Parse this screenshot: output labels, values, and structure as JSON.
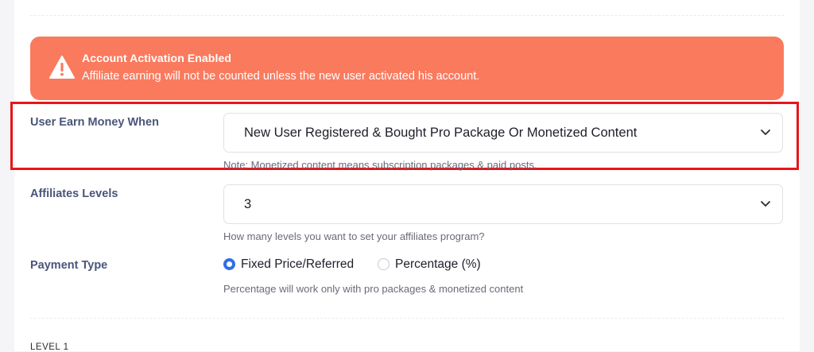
{
  "alert": {
    "title": "Account Activation Enabled",
    "message": "Affiliate earning will not be counted unless the new user activated his account.",
    "icon": "warning-triangle-icon",
    "color": "#fa7a5e"
  },
  "earn_money": {
    "label": "User Earn Money When",
    "selected": "New User Registered & Bought Pro Package Or Monetized Content",
    "note": "Note: Monetized content means subscription packages & paid posts.",
    "highlight_color": "#e8141a"
  },
  "affiliate_levels": {
    "label": "Affiliates Levels",
    "selected": "3",
    "note": "How many levels you want to set your affiliates program?"
  },
  "payment_type": {
    "label": "Payment Type",
    "options": [
      {
        "label": "Fixed Price/Referred",
        "checked": true
      },
      {
        "label": "Percentage (%)",
        "checked": false
      }
    ],
    "note": "Percentage will work only with pro packages & monetized content",
    "accent": "#2f6fe8"
  },
  "level_section": {
    "label": "LEVEL 1"
  }
}
